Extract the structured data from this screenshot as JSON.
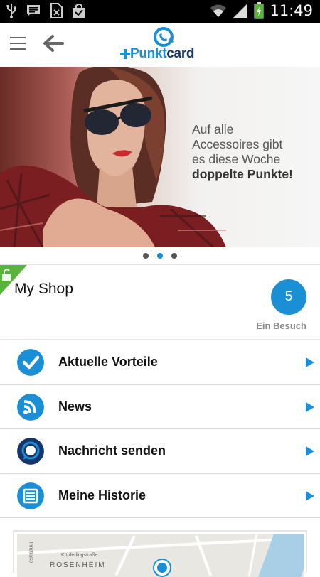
{
  "status_bar": {
    "time": "11:49",
    "icons": [
      "usb-icon",
      "message-icon",
      "sim-icon",
      "shopping-bag-icon",
      "wifi-icon",
      "signal-icon",
      "battery-icon"
    ]
  },
  "app_bar": {
    "logo_part1": "Punkt",
    "logo_part2": "card",
    "icons": [
      "menu-icon",
      "back-arrow-icon"
    ]
  },
  "hero": {
    "line1": "Auf alle",
    "line2": "Accessoires gibt",
    "line3": "es diese Woche",
    "line4": "doppelte Punkte!",
    "dots": 3,
    "active_dot": 2
  },
  "shop": {
    "title": "My Shop",
    "visit_count": "5",
    "visit_label": "Ein Besuch"
  },
  "menu": [
    {
      "label": "Aktuelle Vorteile",
      "icon": "checkmark-icon"
    },
    {
      "label": "News",
      "icon": "rss-icon"
    },
    {
      "label": "Nachricht senden",
      "icon": "chat-icon"
    },
    {
      "label": "Meine Historie",
      "icon": "history-list-icon"
    }
  ],
  "map": {
    "city": "ROSENHEIM",
    "street1": "Küpferlingstraße",
    "street2": "Innstraße"
  },
  "colors": {
    "accent": "#1a8fd6",
    "brand_dark": "#16366b",
    "lock_green": "#5ab43c",
    "chat_navy": "#16366b"
  }
}
